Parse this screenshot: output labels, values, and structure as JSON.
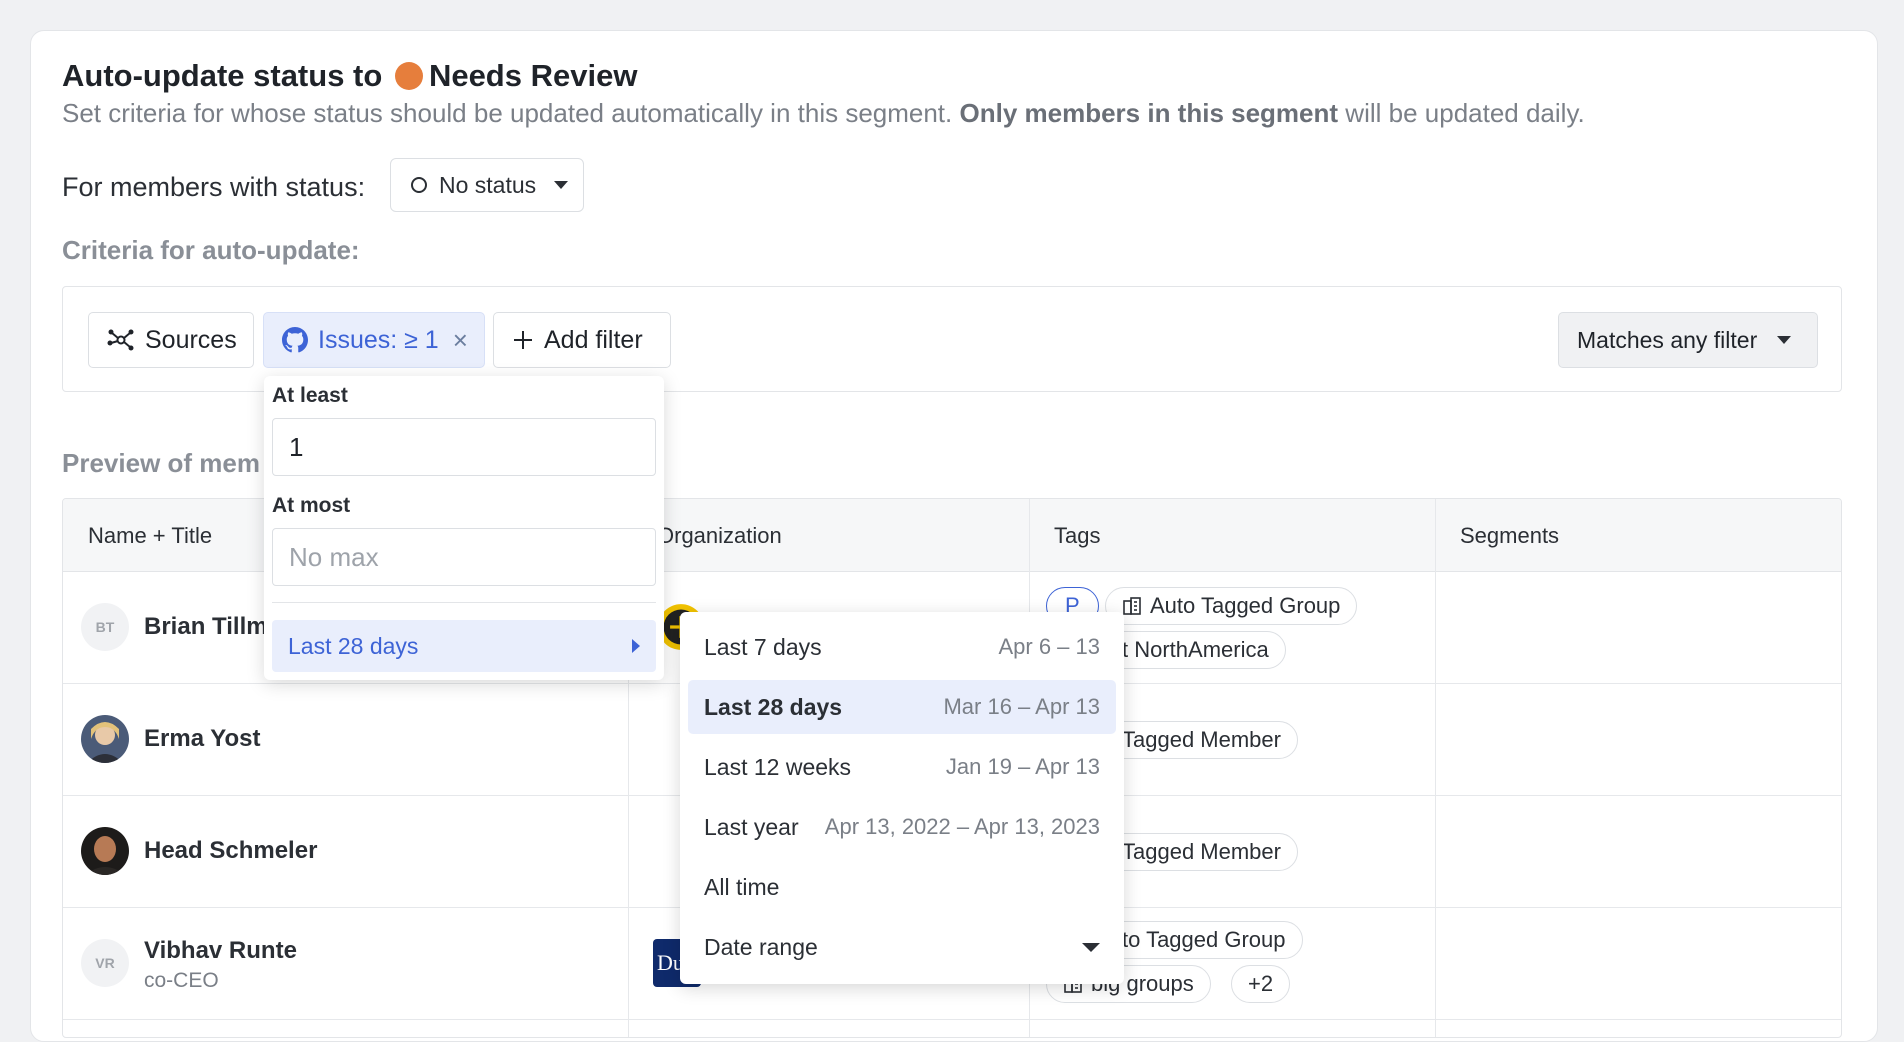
{
  "header": {
    "title_prefix": "Auto-update status to",
    "status_name": "Needs Review",
    "status_color": "#e67e3c",
    "subtitle_start": "Set criteria for whose status should be updated automatically in this segment.",
    "subtitle_bold": "Only members in this segment",
    "subtitle_end": "will be updated daily."
  },
  "status_filter": {
    "label": "For members with status:",
    "value": "No status"
  },
  "criteria": {
    "label": "Criteria for auto-update:",
    "sources_label": "Sources",
    "issues_label": "Issues: ≥ 1",
    "add_filter_label": "Add filter",
    "match_label": "Matches any filter"
  },
  "popover": {
    "at_least_label": "At least",
    "at_least_value": "1",
    "at_most_label": "At most",
    "at_most_placeholder": "No max",
    "period_label": "Last 28 days"
  },
  "period_menu": {
    "items": [
      {
        "label": "Last 7 days",
        "range": "Apr 6 – 13"
      },
      {
        "label": "Last 28 days",
        "range": "Mar 16 – Apr 13",
        "selected": true
      },
      {
        "label": "Last 12 weeks",
        "range": "Jan 19 – Apr 13"
      },
      {
        "label": "Last year",
        "range": "Apr 13, 2022 – Apr 13, 2023"
      },
      {
        "label": "All time",
        "range": ""
      },
      {
        "label": "Date range",
        "range": ""
      }
    ]
  },
  "preview": {
    "label": "Preview of mem",
    "columns": [
      "Name + Title",
      "Organization",
      "Tags",
      "Segments"
    ],
    "rows": [
      {
        "initials": "BT",
        "name": "Brian Tillm",
        "title": "",
        "tags": [
          "P",
          "Auto Tagged Group",
          "t NorthAmerica"
        ]
      },
      {
        "initials": "",
        "name": "Erma Yost",
        "title": "",
        "tags": [
          "Tagged Member"
        ]
      },
      {
        "initials": "",
        "name": "Head Schmeler",
        "title": "",
        "tags": [
          "Tagged Member"
        ]
      },
      {
        "initials": "VR",
        "name": "Vibhav Runte",
        "title": "co-CEO",
        "tags": [
          "to Tagged Group",
          "big groups",
          "+2"
        ]
      }
    ]
  }
}
